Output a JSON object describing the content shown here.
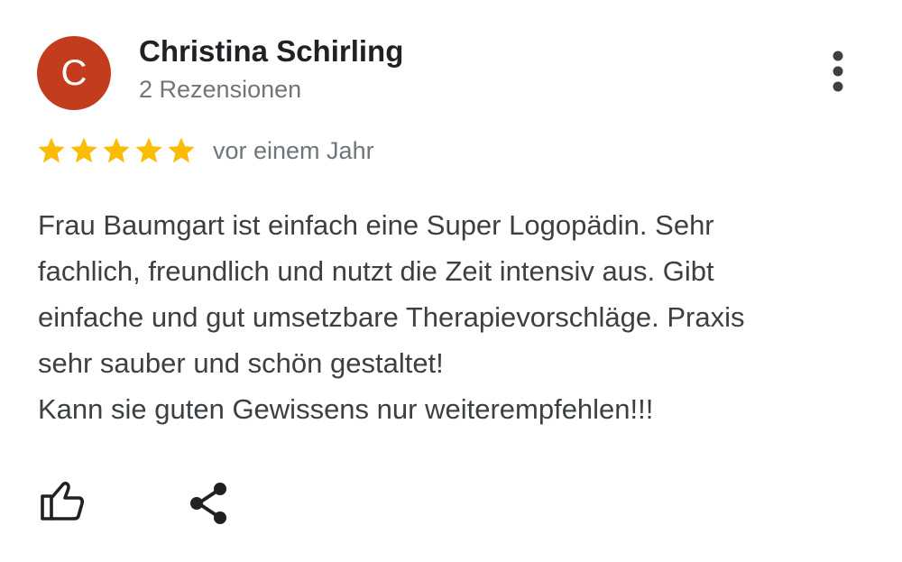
{
  "review": {
    "author": {
      "initial": "C",
      "name": "Christina Schirling",
      "review_count": "2 Rezensionen",
      "avatar_color": "#c43c1e"
    },
    "rating": 5,
    "max_rating": 5,
    "star_color": "#fbbc04",
    "time": "vor einem Jahr",
    "text_lines": [
      "Frau Baumgart ist einfach eine Super Logopädin. Sehr",
      "fachlich, freundlich und nutzt die Zeit intensiv aus. Gibt",
      "einfache und gut umsetzbare Therapievorschläge. Praxis",
      "sehr sauber und schön gestaltet!",
      "Kann sie guten Gewissens nur weiterempfehlen!!!"
    ]
  },
  "actions": {
    "more_icon": "more-vert-icon",
    "like_icon": "thumbs-up-icon",
    "share_icon": "share-icon"
  }
}
